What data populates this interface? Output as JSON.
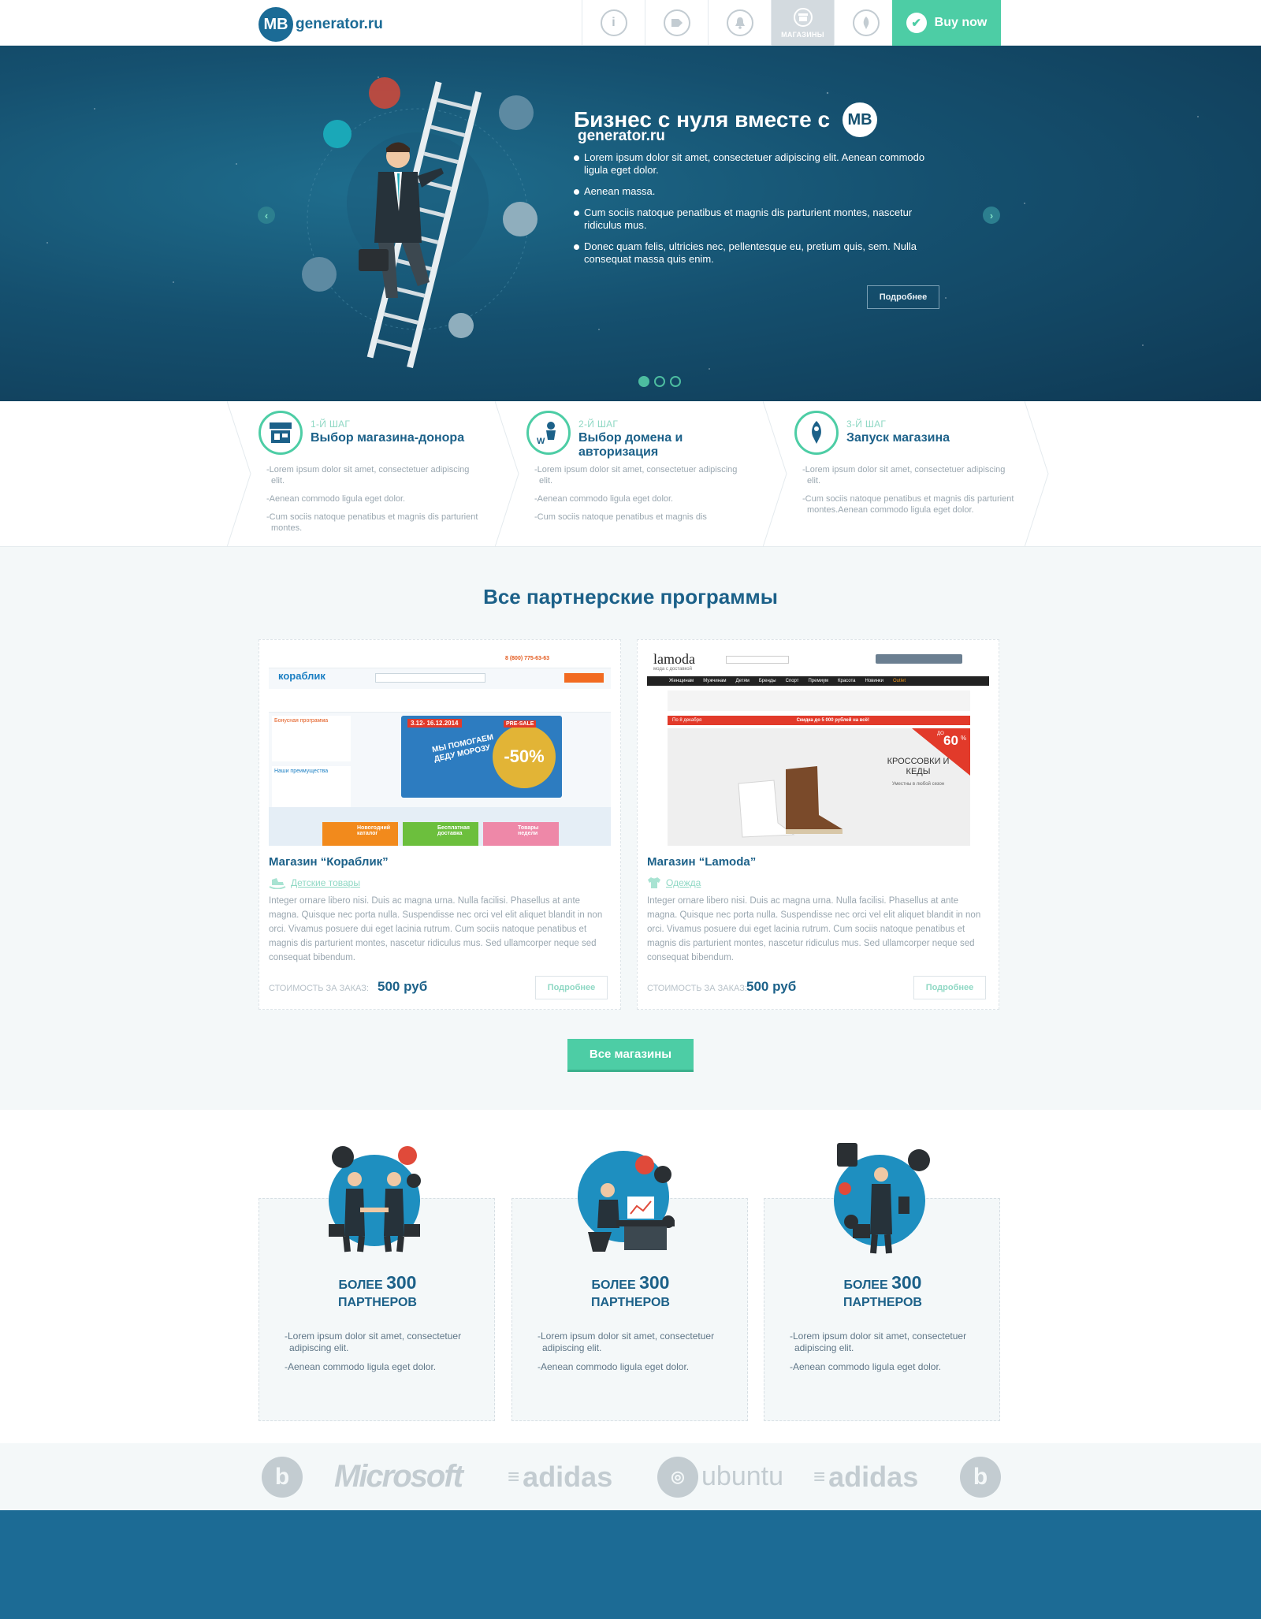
{
  "header": {
    "logo_badge": "MB",
    "logo_text": "generator.ru",
    "nav": [
      {
        "icon": "info-icon",
        "glyph": "i"
      },
      {
        "icon": "tag-icon",
        "glyph": "⌂"
      },
      {
        "icon": "bell-icon",
        "glyph": "♫"
      },
      {
        "icon": "shop-icon",
        "glyph": "▤",
        "label": "МАГАЗИНЫ"
      },
      {
        "icon": "rocket-icon",
        "glyph": "▲"
      }
    ],
    "buy_label": "Buy now"
  },
  "hero": {
    "title": "Бизнес с нуля вместе с",
    "badge": "MB",
    "brand": "generator.ru",
    "bullets": [
      "Lorem ipsum dolor sit amet, consectetuer adipiscing elit. Aenean commodo ligula eget dolor.",
      "Aenean massa.",
      "Cum sociis natoque penatibus et magnis dis parturient montes, nascetur ridiculus mus.",
      "Donec quam felis, ultricies nec, pellentesque eu, pretium quis, sem. Nulla consequat massa quis enim."
    ],
    "more_label": "Подробнее",
    "prev": "‹",
    "next": "›",
    "slides_total": 3,
    "slide_active": 1
  },
  "steps": [
    {
      "num": "1-Й ШАГ",
      "title": "Выбор магазина-донора",
      "icon": "store-icon",
      "items": [
        "-Lorem ipsum dolor sit amet, consectetuer adipiscing elit.",
        "-Aenean commodo ligula eget dolor.",
        "-Cum sociis natoque penatibus et  magnis dis parturient montes."
      ]
    },
    {
      "num": "2-Й ШАГ",
      "title": "Выбор домена и авторизация",
      "icon": "web-user-icon",
      "items": [
        "-Lorem ipsum dolor sit amet, consectetuer adipiscing elit.",
        "-Aenean commodo ligula eget dolor.",
        "-Cum sociis natoque penatibus et  magnis dis"
      ]
    },
    {
      "num": "3-Й ШАГ",
      "title": "Запуск магазина",
      "icon": "rocket-icon",
      "items": [
        "-Lorem ipsum dolor sit amet, consectetuer adipiscing elit.",
        "-Cum sociis natoque penatibus et  magnis dis parturient montes.Aenean commodo ligula eget dolor."
      ]
    }
  ],
  "partners": {
    "title": "Все партнерские программы",
    "cards": [
      {
        "title": "Магазин “Кораблик”",
        "category": "Детские товары",
        "category_icon": "rocking-horse-icon",
        "desc": "Integer ornare libero nisi. Duis ac magna urna. Nulla facilisi. Phasellus at ante magna. Quisque nec porta nulla. Suspendisse nec orci vel elit aliquet blandit in non orci. Vivamus posuere dui eget lacinia rutrum. Cum sociis natoque penatibus et magnis dis parturient montes, nascetur ridiculus mus. Sed ullamcorper neque sed consequat bibendum.",
        "price_label": "СТОИМОСТЬ ЗА ЗАКАЗ:",
        "price": "500 руб",
        "more_label": "Подробнее",
        "shot": {
          "logo": "кораблик",
          "phone": "8 (800) 775-63-63",
          "promo_dates": "3.12- 16.12.2014",
          "promo_text": "МЫ ПОМОГАЕМ ДЕДУ МОРОЗУ",
          "presale": "PRE-SALE",
          "discount": "-50%",
          "side1": "Бонусная программа",
          "side2": "Наши преимущества",
          "tile1": "Новогодний каталог",
          "tile2": "Бесплатная доставка",
          "tile3": "Товары недели"
        }
      },
      {
        "title": "Магазин “Lamoda”",
        "category": "Одежда",
        "category_icon": "tshirt-icon",
        "desc": "Integer ornare libero nisi. Duis ac magna urna. Nulla facilisi. Phasellus at ante magna. Quisque nec porta nulla. Suspendisse nec orci vel elit aliquet blandit in non orci. Vivamus posuere dui eget lacinia rutrum. Cum sociis natoque penatibus et magnis dis parturient montes, nascetur ridiculus mus. Sed ullamcorper neque sed consequat bibendum.",
        "price_label": "СТОИМОСТЬ ЗА ЗАКАЗ:",
        "price": "500 руб",
        "more_label": "Подробнее",
        "shot": {
          "logo": "lamoda",
          "tagline": "мода с доставкой",
          "menu": [
            "Женщинам",
            "Мужчинам",
            "Детям",
            "Бренды",
            "Спорт",
            "Премиум",
            "Красота",
            "Новинки",
            "Outlet"
          ],
          "sale_bar": "Скидка до 5 000 рублей на всё!",
          "sale_left": "По 8 декабря",
          "headline": "КРОССОВКИ И КЕДЫ",
          "sub": "Уместны в любой сезон",
          "discount": "60",
          "discount_prefix": "ДО",
          "discount_suffix": "%"
        }
      }
    ],
    "all_label": "Все магазины"
  },
  "stats": [
    {
      "prefix": "БОЛЕЕ",
      "number": "300",
      "suffix": "ПАРТНЕРОВ",
      "art": "handshake-illustration",
      "items": [
        "-Lorem ipsum dolor sit amet, consectetuer adipiscing elit.",
        "-Aenean commodo ligula eget dolor."
      ]
    },
    {
      "prefix": "БОЛЕЕ",
      "number": "300",
      "suffix": "ПАРТНЕРОВ",
      "art": "office-desk-illustration",
      "items": [
        "-Lorem ipsum dolor sit amet, consectetuer adipiscing elit.",
        "-Aenean commodo ligula eget dolor."
      ]
    },
    {
      "prefix": "БОЛЕЕ",
      "number": "300",
      "suffix": "ПАРТНЕРОВ",
      "art": "mobile-business-illustration",
      "items": [
        "-Lorem ipsum dolor sit amet, consectetuer adipiscing elit.",
        "-Aenean commodo ligula eget dolor."
      ]
    }
  ],
  "brands": {
    "b1_glyph": "b",
    "microsoft": "Microsoft",
    "adidas1": "adidas",
    "ubuntu": "ubuntu",
    "adidas2": "adidas",
    "b2_glyph": "b"
  },
  "colors": {
    "primary": "#1c6189",
    "accent": "#4dcda5",
    "hero_bg": "#15506f",
    "footer": "#1c6b95",
    "muted": "#9aa7b0"
  }
}
